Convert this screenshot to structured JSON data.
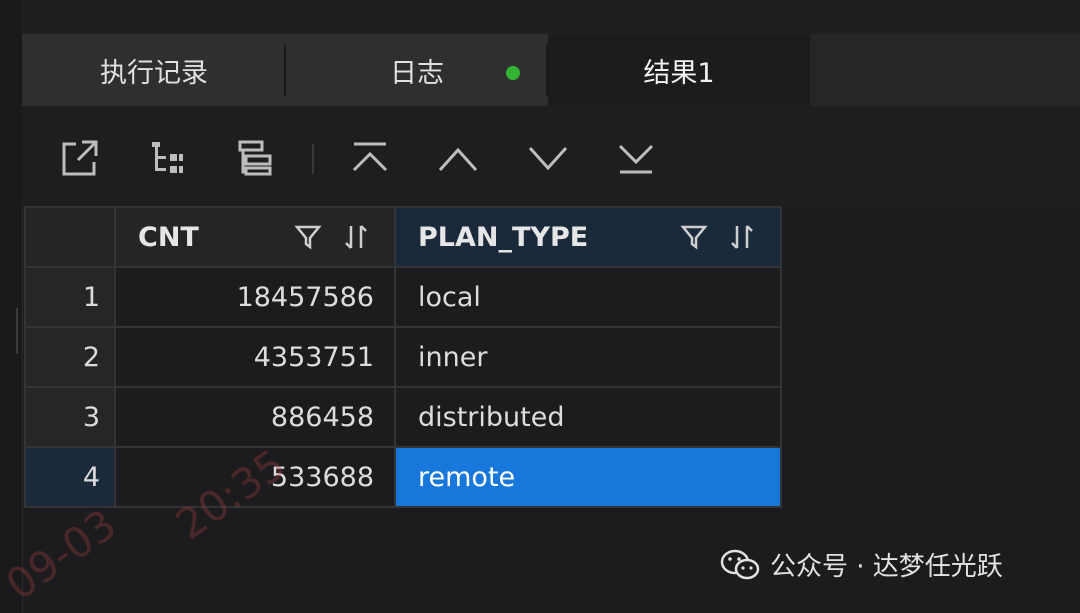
{
  "tabs": [
    {
      "label": "执行记录"
    },
    {
      "label": "日志"
    },
    {
      "label": "结果1"
    }
  ],
  "colors": {
    "tab_dot": "#34b233",
    "selected_cell": "#1777da",
    "selected_header": "#1b2a3a"
  },
  "toolbar": {
    "icons": [
      "export-icon",
      "tree-expand-icon",
      "row-layout-icon",
      "first-icon",
      "up-icon",
      "down-icon",
      "last-icon"
    ]
  },
  "grid": {
    "columns": [
      {
        "name": "CNT"
      },
      {
        "name": "PLAN_TYPE"
      }
    ],
    "rows": [
      {
        "index": "1",
        "cnt": "18457586",
        "plan_type": "local"
      },
      {
        "index": "2",
        "cnt": "4353751",
        "plan_type": "inner"
      },
      {
        "index": "3",
        "cnt": "886458",
        "plan_type": "distributed"
      },
      {
        "index": "4",
        "cnt": "533688",
        "plan_type": "remote"
      }
    ]
  },
  "watermark": {
    "text": "公众号 · 达梦任光跃"
  },
  "faint_watermark": {
    "a": "09-03",
    "b": "20:35"
  }
}
